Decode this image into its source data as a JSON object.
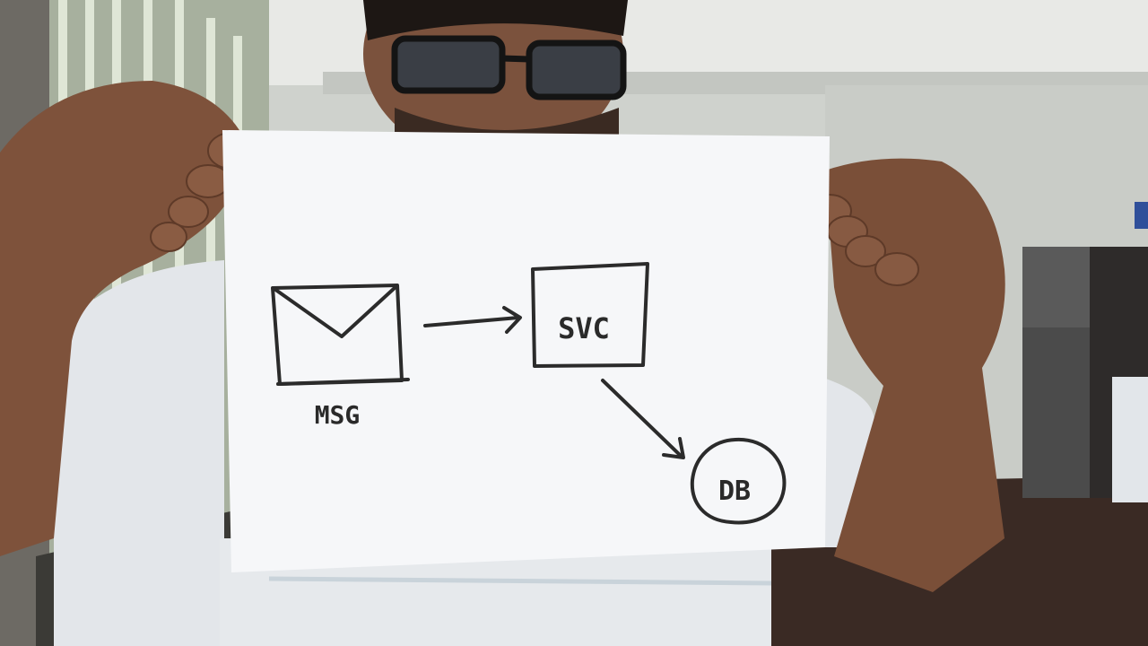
{
  "diagram": {
    "nodes": [
      {
        "id": "msg",
        "label": "MSG",
        "icon": "envelope-icon"
      },
      {
        "id": "svc",
        "label": "SVC"
      },
      {
        "id": "db",
        "label": "DB"
      }
    ],
    "edges": [
      {
        "from": "msg",
        "to": "svc"
      },
      {
        "from": "svc",
        "to": "db"
      }
    ]
  },
  "colors": {
    "paper": "#f6f7f9",
    "ink": "#2b2b2b",
    "shirt": "#e9ecef",
    "skin": "#7a4f38",
    "wall": "#d9dcd8",
    "floor": "#3a2a24",
    "window": "#c9d4c2"
  }
}
